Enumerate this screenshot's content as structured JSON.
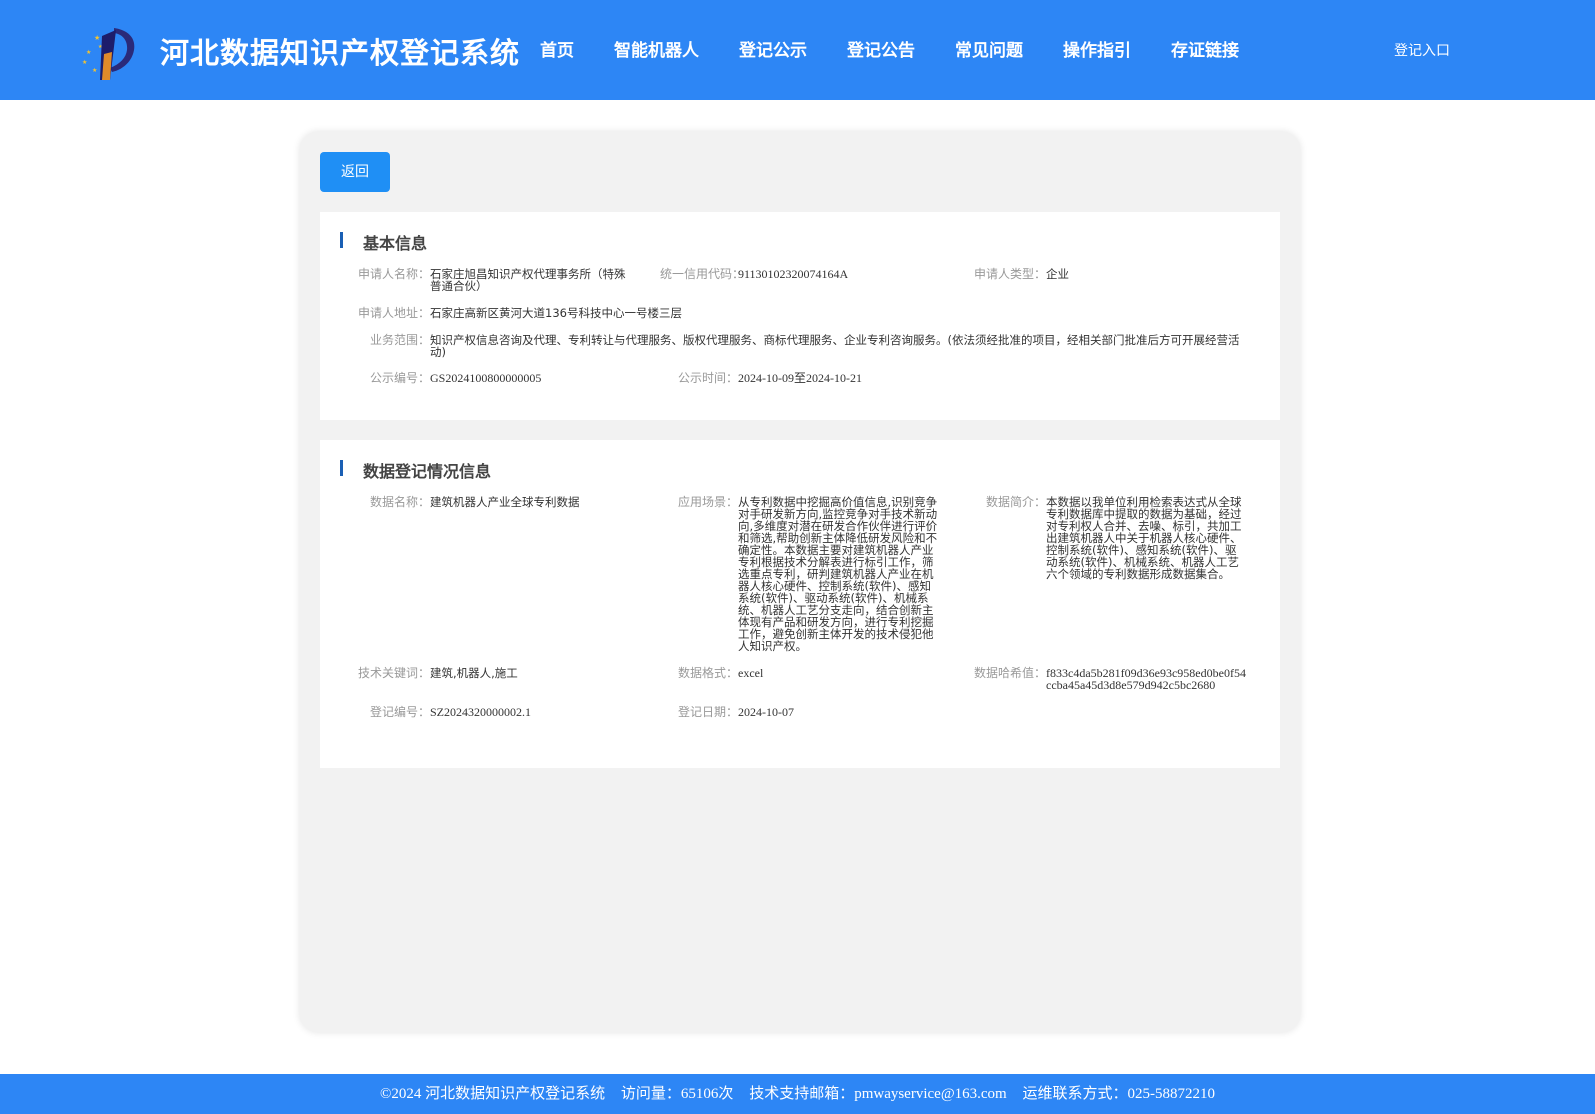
{
  "header": {
    "site_title": "河北数据知识产权登记系统",
    "nav": [
      "首页",
      "智能机器人",
      "登记公示",
      "登记公告",
      "常见问题",
      "操作指引",
      "存证链接"
    ],
    "login_label": "登记入口"
  },
  "back_label": "返回",
  "basic": {
    "title": "基本信息",
    "applicant_name_label": "申请人名称：",
    "applicant_name": "石家庄旭昌知识产权代理事务所（特殊普通合伙）",
    "credit_code_label": "统一信用代码：",
    "credit_code": "91130102320074164A",
    "applicant_type_label": "申请人类型：",
    "applicant_type": "企业",
    "address_label": "申请人地址：",
    "address": "石家庄高新区黄河大道136号科技中心一号楼三层",
    "scope_label": "业务范围：",
    "scope": "知识产权信息咨询及代理、专利转让与代理服务、版权代理服务、商标代理服务、企业专利咨询服务。(依法须经批准的项目，经相关部门批准后方可开展经营活动)",
    "notice_no_label": "公示编号：",
    "notice_no": "GS2024100800000005",
    "notice_time_label": "公示时间：",
    "notice_time": "2024-10-09至2024-10-21"
  },
  "data_info": {
    "title": "数据登记情况信息",
    "data_name_label": "数据名称：",
    "data_name": "建筑机器人产业全球专利数据",
    "scenario_label": "应用场景：",
    "scenario": "从专利数据中挖掘高价值信息,识别竞争对手研发新方向,监控竞争对手技术新动向,多维度对潜在研发合作伙伴进行评价和筛选,帮助创新主体降低研发风险和不确定性。本数据主要对建筑机器人产业专利根据技术分解表进行标引工作，筛选重点专利，研判建筑机器人产业在机器人核心硬件、控制系统(软件)、感知系统(软件)、驱动系统(软件)、机械系统、机器人工艺分支走向，结合创新主体现有产品和研发方向，进行专利挖掘工作，避免创新主体开发的技术侵犯他人知识产权。",
    "intro_label": "数据简介：",
    "intro": "本数据以我单位利用检索表达式从全球专利数据库中提取的数据为基础，经过对专利权人合并、去噪、标引，共加工出建筑机器人中关于机器人核心硬件、控制系统(软件)、感知系统(软件)、驱动系统(软件)、机械系统、机器人工艺六个领域的专利数据形成数据集合。",
    "keywords_label": "技术关键词：",
    "keywords": "建筑,机器人,施工",
    "format_label": "数据格式：",
    "format": "excel",
    "hash_label": "数据哈希值：",
    "hash": "f833c4da5b281f09d36e93c958ed0be0f54ccba45a45d3d8e579d942c5bc2680",
    "reg_no_label": "登记编号：",
    "reg_no": "SZ2024320000002.1",
    "reg_date_label": "登记日期：",
    "reg_date": "2024-10-07"
  },
  "footer": {
    "copyright": "©2024 河北数据知识产权登记系统",
    "visits": "访问量：65106次",
    "email": "技术支持邮箱：pmwayservice@163.com",
    "phone": "运维联系方式：025-58872210"
  },
  "colors": {
    "header_bg": "#2d86f5",
    "button_bg": "#1f8ff5",
    "section_bar": "#1a5fb4",
    "panel_bg": "#f2f2f2"
  }
}
